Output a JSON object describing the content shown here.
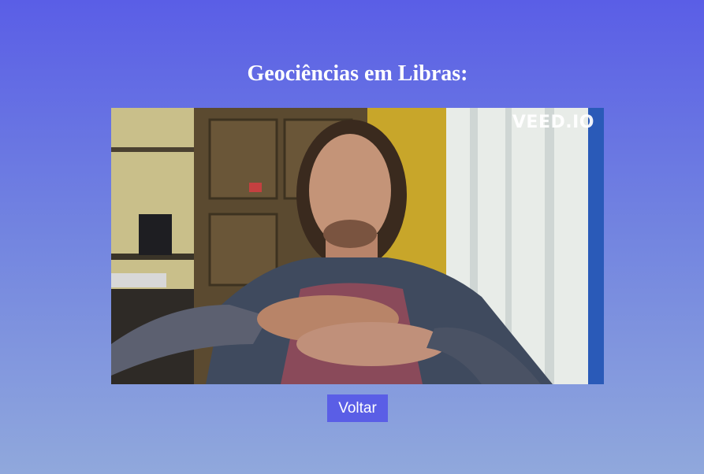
{
  "page": {
    "title": "Geociências em Libras:"
  },
  "video": {
    "watermark": "VEED.IO"
  },
  "actions": {
    "back_label": "Voltar"
  },
  "colors": {
    "accent": "#5a5ee6",
    "background_top": "#5a5ee6",
    "background_bottom": "#90a8dc",
    "text": "#ffffff"
  }
}
